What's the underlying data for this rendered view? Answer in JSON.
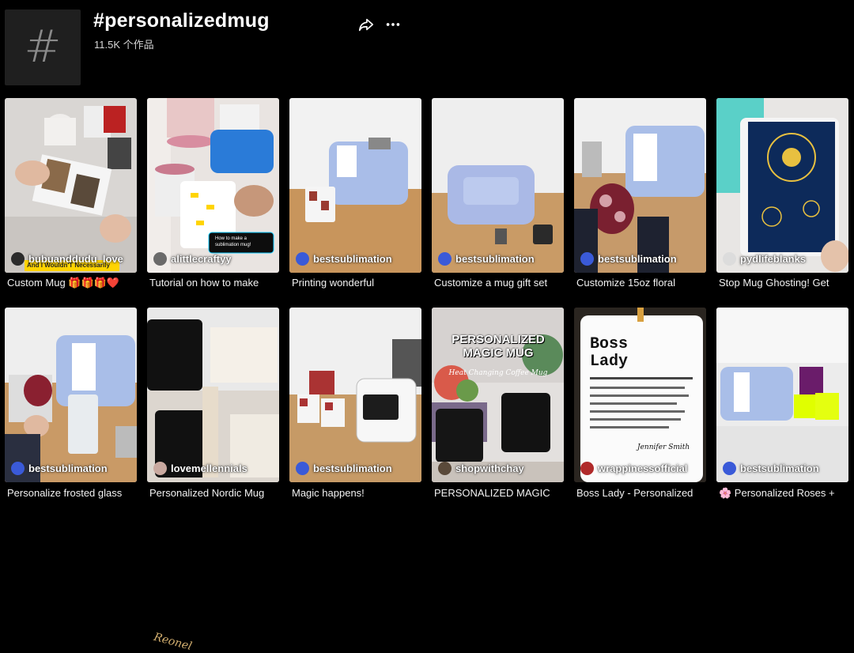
{
  "header": {
    "hashtag_icon": "hash-icon",
    "title": "#personalizedmug",
    "count": "11.5K 个作品",
    "share_icon": "share-icon",
    "more_icon": "more-icon"
  },
  "videos": [
    {
      "author": "bubuanddudu_love",
      "caption": "Custom Mug 🎁🎁🎁❤️",
      "overlay": "And I Wouldn'T Necessarily",
      "avatar_color": "#2b2b2b"
    },
    {
      "author": "alittlecraftyy",
      "caption": "Tutorial on how to make",
      "overlay": "How to make a sublimation mug!",
      "avatar_color": "#6a6a6a"
    },
    {
      "author": "bestsublimation",
      "caption": "Printing wonderful",
      "avatar_color": "#3a5ad8"
    },
    {
      "author": "bestsublimation",
      "caption": "Customize a mug gift set",
      "avatar_color": "#3a5ad8"
    },
    {
      "author": "bestsublimation",
      "caption": "Customize 15oz floral",
      "avatar_color": "#3a5ad8"
    },
    {
      "author": "pydlifeblanks",
      "caption": "Stop Mug Ghosting! Get",
      "avatar_color": "#dcdcdc"
    },
    {
      "author": "bestsublimation",
      "caption": "Personalize frosted glass",
      "avatar_color": "#3a5ad8"
    },
    {
      "author": "lovemellennials",
      "caption": "Personalized Nordic Mug",
      "overlay": "Reonel",
      "avatar_color": "#c9a9a0"
    },
    {
      "author": "bestsublimation",
      "caption": "Magic happens!",
      "avatar_color": "#3a5ad8"
    },
    {
      "author": "shopwithchay",
      "caption": "PERSONALIZED MAGIC",
      "overlay": "PERSONALIZED MAGIC MUG",
      "overlay2": "Heat Changing Coffee Mug",
      "avatar_color": "#5a4a3a"
    },
    {
      "author": "wrappinessofficial",
      "caption": "Boss Lady - Personalized",
      "overlay": "Boss Lady",
      "overlay2": "Jennifer Smith",
      "avatar_color": "#b02a2a"
    },
    {
      "author": "bestsublimation",
      "caption": "🌸 Personalized Roses +",
      "avatar_color": "#3a5ad8"
    }
  ]
}
